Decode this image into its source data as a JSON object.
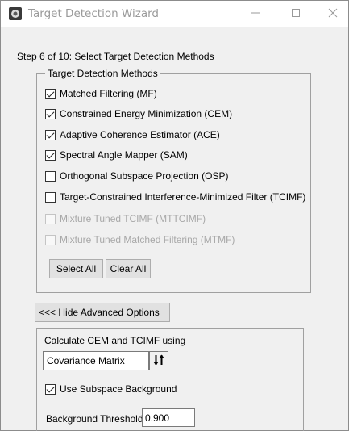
{
  "window": {
    "title": "Target Detection Wizard",
    "app_icon": "wizard-app-icon"
  },
  "step": {
    "label": "Step 6 of 10: Select Target Detection Methods"
  },
  "methods_group": {
    "legend": "Target Detection Methods",
    "items": [
      {
        "label": "Matched Filtering (MF)",
        "checked": true,
        "enabled": true
      },
      {
        "label": "Constrained Energy Minimization (CEM)",
        "checked": true,
        "enabled": true
      },
      {
        "label": "Adaptive Coherence Estimator (ACE)",
        "checked": true,
        "enabled": true
      },
      {
        "label": "Spectral Angle Mapper (SAM)",
        "checked": true,
        "enabled": true
      },
      {
        "label": "Orthogonal Subspace Projection (OSP)",
        "checked": false,
        "enabled": true
      },
      {
        "label": "Target-Constrained Interference-Minimized Filter (TCIMF)",
        "checked": false,
        "enabled": true
      },
      {
        "label": "Mixture Tuned TCIMF (MTTCIMF)",
        "checked": false,
        "enabled": false
      },
      {
        "label": "Mixture Tuned Matched Filtering (MTMF)",
        "checked": false,
        "enabled": false
      }
    ],
    "select_all": "Select All",
    "clear_all": "Clear All"
  },
  "advanced": {
    "toggle_label": "<<< Hide Advanced Options"
  },
  "cem_group": {
    "title": "Calculate CEM and TCIMF using",
    "select_value": "Covariance Matrix",
    "sort_icon": "sort-arrows-icon",
    "subspace_label": "Use Subspace Background",
    "subspace_checked": true,
    "threshold_label": "Background Threshold",
    "threshold_value": "0.900"
  }
}
